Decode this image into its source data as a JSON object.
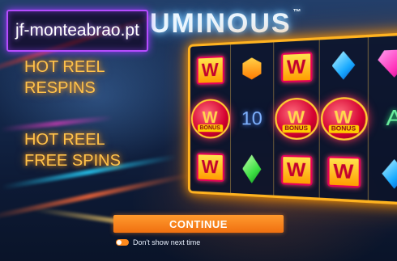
{
  "site_badge": {
    "text": "jf-monteabrao.pt"
  },
  "game": {
    "title": "UMINOUS",
    "trademark": "™"
  },
  "features": [
    {
      "lines": [
        "HOT REEL",
        "RESPINS"
      ]
    },
    {
      "lines": [
        "HOT REEL",
        "FREE SPINS"
      ]
    }
  ],
  "reels": {
    "rows": [
      [
        {
          "type": "wild",
          "label": "W"
        },
        {
          "type": "gem",
          "icon": "orange-gem-icon"
        },
        {
          "type": "wild",
          "label": "W"
        },
        {
          "type": "gem",
          "icon": "blue-gem-icon"
        },
        {
          "type": "gem",
          "icon": "pink-gem-icon"
        }
      ],
      [
        {
          "type": "bonus",
          "label": "W",
          "badge": "BONUS"
        },
        {
          "type": "text",
          "label": "10"
        },
        {
          "type": "bonus",
          "label": "W",
          "badge": "BONUS"
        },
        {
          "type": "bonus",
          "label": "W",
          "badge": "BONUS"
        },
        {
          "type": "letter",
          "label": "A"
        }
      ],
      [
        {
          "type": "wild",
          "label": "W"
        },
        {
          "type": "gem",
          "icon": "green-gem-icon"
        },
        {
          "type": "wild",
          "label": "W"
        },
        {
          "type": "wild",
          "label": "W"
        },
        {
          "type": "gem",
          "icon": "blue-gem-icon"
        }
      ]
    ]
  },
  "continue_button": {
    "label": "CONTINUE"
  },
  "dont_show": {
    "label": "Don't show next time",
    "checked": true
  },
  "colors": {
    "accent": "#ff8a1d",
    "feature_text": "#ffc24a",
    "badge_border": "#b54cff",
    "frame": "#ffb320"
  }
}
